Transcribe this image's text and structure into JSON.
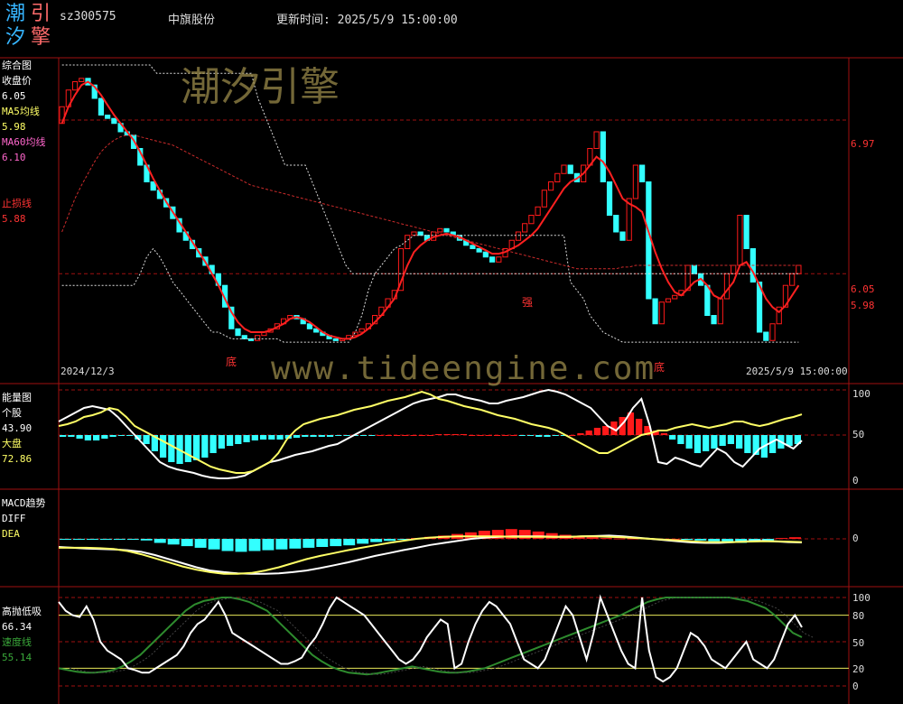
{
  "header": {
    "logo_chars": [
      "潮",
      "引",
      "汐",
      "擎"
    ],
    "code": "sz300575",
    "name": "中旗股份",
    "update_time": "更新时间: 2025/5/9 15:00:00"
  },
  "watermark": {
    "title": "潮汐引擎",
    "url": "www.tideengine.com"
  },
  "colors": {
    "up": "#ff1a1a",
    "down": "#33ffff",
    "ma60": "#cc2b2b",
    "ma5": "#ffff66",
    "grid": "#a01010",
    "dash_grid": "#a01010",
    "kdj_green": "#2e8b2e"
  },
  "panels": {
    "main": {
      "title": "综合图",
      "close_label": "收盘价",
      "close_value": "6.05",
      "ma5_label": "MA5均线",
      "ma5_value": "5.98",
      "ma60_label": "MA60均线",
      "ma60_value": "6.10",
      "stop_label": "止损线",
      "stop_value": "5.88",
      "right_ticks": [
        "6.97",
        "6.05",
        "5.98"
      ],
      "start_date": "2024/12/3",
      "end_date": "2025/5/9 15:00:00",
      "markers": [
        "底",
        "强",
        "底"
      ]
    },
    "energy": {
      "title": "能量图",
      "stock_label": "个股",
      "stock_value": "43.90",
      "market_label": "大盘",
      "market_value": "72.86",
      "ticks": [
        "100",
        "50",
        "0"
      ]
    },
    "macd": {
      "title": "MACD趋势",
      "diff_label": "DIFF",
      "dea_label": "DEA",
      "ticks": [
        "0"
      ]
    },
    "kdj": {
      "title": "高抛低吸",
      "value": "66.34",
      "speed_label": "速度线",
      "speed_value": "55.14",
      "ticks": [
        "100",
        "80",
        "50",
        "20",
        "0"
      ]
    }
  },
  "chart_data": [
    {
      "type": "candlestick",
      "name": "综合图",
      "x": [
        "2024/12/3",
        "2025/5/9"
      ],
      "ylim": [
        5.5,
        7.3
      ],
      "close": [
        7.05,
        7.15,
        7.2,
        7.22,
        7.18,
        7.1,
        7.0,
        6.98,
        6.95,
        6.9,
        6.88,
        6.8,
        6.7,
        6.6,
        6.55,
        6.5,
        6.45,
        6.38,
        6.3,
        6.25,
        6.2,
        6.15,
        6.1,
        6.05,
        5.98,
        5.85,
        5.72,
        5.68,
        5.66,
        5.65,
        5.68,
        5.7,
        5.72,
        5.75,
        5.78,
        5.8,
        5.78,
        5.75,
        5.72,
        5.7,
        5.68,
        5.66,
        5.65,
        5.66,
        5.68,
        5.7,
        5.72,
        5.75,
        5.8,
        5.85,
        5.9,
        5.95,
        6.2,
        6.28,
        6.3,
        6.28,
        6.25,
        6.3,
        6.32,
        6.3,
        6.28,
        6.25,
        6.22,
        6.2,
        6.18,
        6.15,
        6.12,
        6.15,
        6.2,
        6.25,
        6.3,
        6.35,
        6.4,
        6.45,
        6.55,
        6.6,
        6.65,
        6.7,
        6.65,
        6.6,
        6.7,
        6.8,
        6.9,
        6.6,
        6.4,
        6.3,
        6.25,
        6.5,
        6.7,
        6.6,
        5.9,
        5.75,
        5.88,
        5.9,
        5.92,
        5.95,
        6.1,
        6.05,
        5.98,
        5.8,
        5.75,
        5.9,
        6.05,
        6.1,
        6.4,
        6.2,
        6.0,
        5.7,
        5.65,
        5.75,
        5.85,
        5.98,
        6.05,
        6.1
      ],
      "ma5": [
        6.95,
        7.05,
        7.12,
        7.18,
        7.2,
        7.17,
        7.12,
        7.06,
        7.0,
        6.95,
        6.9,
        6.85,
        6.78,
        6.7,
        6.62,
        6.55,
        6.48,
        6.42,
        6.36,
        6.3,
        6.24,
        6.18,
        6.12,
        6.05,
        5.98,
        5.9,
        5.82,
        5.76,
        5.72,
        5.7,
        5.7,
        5.7,
        5.71,
        5.73,
        5.75,
        5.78,
        5.79,
        5.78,
        5.76,
        5.73,
        5.7,
        5.68,
        5.67,
        5.66,
        5.66,
        5.67,
        5.69,
        5.72,
        5.76,
        5.8,
        5.85,
        5.9,
        6.0,
        6.1,
        6.18,
        6.22,
        6.25,
        6.27,
        6.28,
        6.29,
        6.28,
        6.27,
        6.25,
        6.23,
        6.21,
        6.19,
        6.17,
        6.17,
        6.18,
        6.2,
        6.22,
        6.25,
        6.28,
        6.32,
        6.38,
        6.44,
        6.5,
        6.56,
        6.6,
        6.62,
        6.65,
        6.7,
        6.75,
        6.72,
        6.66,
        6.58,
        6.5,
        6.47,
        6.45,
        6.42,
        6.3,
        6.18,
        6.08,
        6.0,
        5.94,
        5.92,
        5.96,
        6.0,
        6.02,
        5.98,
        5.92,
        5.9,
        5.95,
        6.0,
        6.1,
        6.12,
        6.06,
        5.98,
        5.9,
        5.85,
        5.82,
        5.86,
        5.92,
        5.98
      ],
      "ma60": [
        6.3,
        6.4,
        6.5,
        6.58,
        6.65,
        6.72,
        6.78,
        6.82,
        6.85,
        6.87,
        6.88,
        6.88,
        6.87,
        6.86,
        6.85,
        6.84,
        6.83,
        6.82,
        6.8,
        6.78,
        6.76,
        6.74,
        6.72,
        6.7,
        6.68,
        6.66,
        6.64,
        6.62,
        6.6,
        6.58,
        6.57,
        6.56,
        6.55,
        6.54,
        6.53,
        6.52,
        6.51,
        6.5,
        6.49,
        6.48,
        6.47,
        6.46,
        6.45,
        6.44,
        6.43,
        6.42,
        6.41,
        6.4,
        6.39,
        6.38,
        6.37,
        6.36,
        6.35,
        6.34,
        6.33,
        6.32,
        6.31,
        6.3,
        6.29,
        6.28,
        6.27,
        6.26,
        6.25,
        6.24,
        6.23,
        6.22,
        6.21,
        6.2,
        6.19,
        6.18,
        6.17,
        6.16,
        6.15,
        6.14,
        6.13,
        6.12,
        6.11,
        6.1,
        6.09,
        6.08,
        6.08,
        6.08,
        6.08,
        6.08,
        6.08,
        6.08,
        6.09,
        6.09,
        6.1,
        6.1,
        6.1,
        6.1,
        6.1,
        6.1,
        6.1,
        6.1,
        6.1,
        6.1,
        6.1,
        6.1,
        6.1,
        6.1,
        6.1,
        6.1,
        6.1,
        6.1,
        6.1,
        6.1,
        6.1,
        6.1,
        6.1,
        6.1,
        6.1,
        6.1
      ],
      "stop_upper": [
        7.3,
        7.3,
        7.3,
        7.3,
        7.3,
        7.3,
        7.3,
        7.3,
        7.3,
        7.3,
        7.3,
        7.3,
        7.3,
        7.3,
        7.25,
        7.25,
        7.25,
        7.25,
        7.25,
        7.25,
        7.25,
        7.25,
        7.25,
        7.25,
        7.25,
        7.25,
        7.25,
        7.25,
        7.25,
        7.1,
        7.0,
        6.9,
        6.8,
        6.7,
        6.7,
        6.7,
        6.7,
        6.6,
        6.5,
        6.4,
        6.3,
        6.2,
        6.1,
        6.05,
        6.05,
        6.05,
        6.05,
        6.05,
        6.05,
        6.05,
        6.05,
        6.05,
        6.05,
        6.05,
        6.05,
        6.05,
        6.05,
        6.05,
        6.05,
        6.05,
        6.05,
        6.05,
        6.05,
        6.05,
        6.05,
        6.05,
        6.05,
        6.05,
        6.05,
        6.05,
        6.05,
        6.05,
        6.05,
        6.05,
        6.05,
        6.05,
        6.05,
        6.05,
        6.05,
        6.05,
        6.05,
        6.05,
        6.05,
        6.05,
        6.05,
        6.05,
        6.05,
        6.05,
        6.05,
        6.05,
        6.05,
        6.05,
        6.05,
        6.05,
        6.05,
        6.05,
        6.05,
        6.05,
        6.05,
        6.05,
        6.05,
        6.05,
        6.05,
        6.05,
        6.05,
        6.05,
        6.05,
        6.05,
        6.05,
        6.05
      ],
      "stop_lower": [
        5.98,
        5.98,
        5.98,
        5.98,
        5.98,
        5.98,
        5.98,
        5.98,
        5.98,
        5.98,
        5.98,
        5.98,
        6.05,
        6.15,
        6.2,
        6.15,
        6.08,
        6.0,
        5.95,
        5.9,
        5.85,
        5.8,
        5.75,
        5.7,
        5.7,
        5.68,
        5.66,
        5.66,
        5.66,
        5.66,
        5.66,
        5.66,
        5.66,
        5.66,
        5.64,
        5.64,
        5.64,
        5.64,
        5.64,
        5.64,
        5.64,
        5.64,
        5.64,
        5.64,
        5.64,
        5.7,
        5.8,
        5.95,
        6.05,
        6.1,
        6.15,
        6.2,
        6.22,
        6.25,
        6.28,
        6.28,
        6.28,
        6.28,
        6.28,
        6.28,
        6.28,
        6.28,
        6.28,
        6.28,
        6.28,
        6.28,
        6.28,
        6.28,
        6.28,
        6.28,
        6.28,
        6.28,
        6.28,
        6.28,
        6.28,
        6.28,
        6.28,
        6.28,
        6.0,
        5.95,
        5.9,
        5.8,
        5.75,
        5.7,
        5.68,
        5.66,
        5.64,
        5.64,
        5.64,
        5.64,
        5.64,
        5.64,
        5.64,
        5.64,
        5.64,
        5.64,
        5.64,
        5.64,
        5.64,
        5.64,
        5.64,
        5.64,
        5.64,
        5.64,
        5.64,
        5.64,
        5.64,
        5.64,
        5.64,
        5.64,
        5.64,
        5.64,
        5.64,
        5.64
      ]
    },
    {
      "type": "line+bar",
      "name": "能量图",
      "ylim": [
        0,
        100
      ],
      "stock": [
        65,
        70,
        75,
        80,
        82,
        80,
        78,
        70,
        60,
        50,
        40,
        30,
        20,
        15,
        12,
        10,
        8,
        5,
        3,
        2,
        2,
        3,
        5,
        10,
        15,
        20,
        22,
        25,
        28,
        30,
        32,
        35,
        38,
        40,
        45,
        50,
        55,
        60,
        65,
        70,
        75,
        80,
        85,
        88,
        90,
        92,
        95,
        95,
        92,
        90,
        88,
        85,
        85,
        88,
        90,
        92,
        95,
        98,
        100,
        98,
        95,
        90,
        85,
        80,
        70,
        60,
        55,
        65,
        80,
        90,
        60,
        20,
        18,
        25,
        22,
        18,
        15,
        25,
        35,
        30,
        20,
        15,
        25,
        35,
        40,
        45,
        40,
        35,
        43.9
      ],
      "market": [
        60,
        62,
        65,
        70,
        72,
        75,
        80,
        78,
        70,
        60,
        55,
        50,
        45,
        40,
        35,
        30,
        25,
        20,
        15,
        12,
        10,
        8,
        8,
        10,
        15,
        20,
        30,
        45,
        55,
        62,
        65,
        68,
        70,
        72,
        75,
        78,
        80,
        82,
        85,
        88,
        90,
        92,
        95,
        98,
        95,
        90,
        88,
        85,
        82,
        80,
        78,
        75,
        72,
        70,
        68,
        65,
        62,
        60,
        58,
        55,
        50,
        45,
        40,
        35,
        30,
        30,
        35,
        40,
        45,
        50,
        52,
        55,
        55,
        58,
        60,
        62,
        60,
        58,
        60,
        62,
        65,
        65,
        62,
        60,
        62,
        65,
        68,
        70,
        72.86
      ],
      "bars": [
        -2,
        -2,
        -4,
        -6,
        -6,
        -4,
        -2,
        -1,
        -1,
        -5,
        -10,
        -18,
        -25,
        -30,
        -32,
        -30,
        -28,
        -25,
        -20,
        -15,
        -12,
        -10,
        -8,
        -6,
        -5,
        -5,
        -5,
        -4,
        -3,
        -2,
        -2,
        -2,
        -2,
        -1,
        -1,
        -1,
        -1,
        -1,
        0,
        0,
        0,
        0,
        0,
        0,
        0,
        1,
        1,
        1,
        1,
        0,
        0,
        0,
        0,
        0,
        0,
        -1,
        -1,
        -2,
        -2,
        -1,
        -1,
        0,
        2,
        5,
        8,
        10,
        15,
        20,
        25,
        18,
        10,
        5,
        2,
        -5,
        -10,
        -15,
        -20,
        -18,
        -15,
        -12,
        -10,
        -15,
        -20,
        -22,
        -25,
        -20,
        -15,
        -12,
        -10
      ]
    },
    {
      "type": "line+bar",
      "name": "MACD趋势",
      "diff": [
        -0.2,
        -0.22,
        -0.24,
        -0.25,
        -0.26,
        -0.28,
        -0.32,
        -0.4,
        -0.5,
        -0.6,
        -0.7,
        -0.78,
        -0.82,
        -0.85,
        -0.86,
        -0.86,
        -0.85,
        -0.82,
        -0.78,
        -0.72,
        -0.65,
        -0.58,
        -0.5,
        -0.42,
        -0.35,
        -0.28,
        -0.22,
        -0.15,
        -0.1,
        -0.05,
        0.0,
        0.03,
        0.05,
        0.06,
        0.06,
        0.06,
        0.05,
        0.05,
        0.06,
        0.07,
        0.08,
        0.06,
        0.03,
        0.0,
        -0.03,
        -0.06,
        -0.09,
        -0.1,
        -0.1,
        -0.08,
        -0.06,
        -0.05,
        -0.06,
        -0.08,
        -0.09
      ],
      "dea": [
        -0.22,
        -0.22,
        -0.22,
        -0.23,
        -0.25,
        -0.3,
        -0.38,
        -0.48,
        -0.58,
        -0.68,
        -0.76,
        -0.82,
        -0.86,
        -0.86,
        -0.84,
        -0.78,
        -0.7,
        -0.6,
        -0.5,
        -0.42,
        -0.35,
        -0.28,
        -0.22,
        -0.16,
        -0.1,
        -0.05,
        0.0,
        0.03,
        0.05,
        0.06,
        0.06,
        0.06,
        0.06,
        0.05,
        0.05,
        0.05,
        0.05,
        0.05,
        0.06,
        0.06,
        0.05,
        0.04,
        0.02,
        0.0,
        -0.02,
        -0.04,
        -0.06,
        -0.08,
        -0.08,
        -0.08,
        -0.07,
        -0.06,
        -0.06,
        -0.07,
        -0.08
      ],
      "bars": [
        -0.02,
        -0.02,
        -0.02,
        -0.02,
        -0.02,
        -0.02,
        -0.04,
        -0.1,
        -0.14,
        -0.18,
        -0.22,
        -0.26,
        -0.3,
        -0.32,
        -0.3,
        -0.28,
        -0.26,
        -0.24,
        -0.22,
        -0.2,
        -0.18,
        -0.16,
        -0.12,
        -0.08,
        -0.05,
        -0.02,
        0.02,
        0.05,
        0.08,
        0.12,
        0.16,
        0.2,
        0.22,
        0.24,
        0.22,
        0.18,
        0.14,
        0.1,
        0.06,
        0.04,
        0.02,
        0.01,
        0.01,
        0.01,
        0.0,
        0.0,
        -0.02,
        -0.04,
        -0.06,
        -0.08,
        -0.1,
        -0.08,
        -0.04,
        0.02,
        0.04
      ]
    },
    {
      "type": "line",
      "name": "高抛低吸",
      "ylim": [
        0,
        100
      ],
      "fast": [
        95,
        85,
        80,
        78,
        90,
        75,
        50,
        40,
        35,
        30,
        20,
        18,
        15,
        15,
        20,
        25,
        30,
        35,
        45,
        60,
        70,
        75,
        85,
        95,
        80,
        60,
        55,
        50,
        45,
        40,
        35,
        30,
        25,
        25,
        28,
        32,
        45,
        55,
        70,
        88,
        100,
        95,
        90,
        85,
        80,
        70,
        60,
        50,
        40,
        30,
        25,
        30,
        40,
        55,
        65,
        75,
        70,
        20,
        25,
        50,
        70,
        85,
        95,
        90,
        80,
        70,
        50,
        30,
        25,
        20,
        30,
        50,
        70,
        90,
        80,
        55,
        30,
        60,
        100,
        80,
        60,
        40,
        25,
        20,
        100,
        40,
        10,
        5,
        10,
        20,
        40,
        60,
        55,
        45,
        30,
        25,
        20,
        30,
        40,
        50,
        30,
        25,
        20,
        30,
        50,
        70,
        80,
        66.34
      ],
      "speed": [
        20,
        18,
        16,
        15,
        15,
        16,
        18,
        22,
        28,
        35,
        45,
        55,
        65,
        75,
        85,
        92,
        96,
        98,
        100,
        100,
        98,
        95,
        90,
        85,
        75,
        65,
        55,
        45,
        35,
        28,
        22,
        18,
        15,
        14,
        13,
        14,
        16,
        18,
        20,
        22,
        20,
        18,
        16,
        15,
        15,
        16,
        18,
        20,
        24,
        28,
        32,
        36,
        40,
        44,
        48,
        52,
        56,
        60,
        64,
        68,
        72,
        76,
        80,
        85,
        90,
        95,
        98,
        100,
        100,
        100,
        100,
        100,
        100,
        100,
        100,
        98,
        96,
        92,
        88,
        80,
        70,
        60,
        55.14
      ]
    }
  ]
}
